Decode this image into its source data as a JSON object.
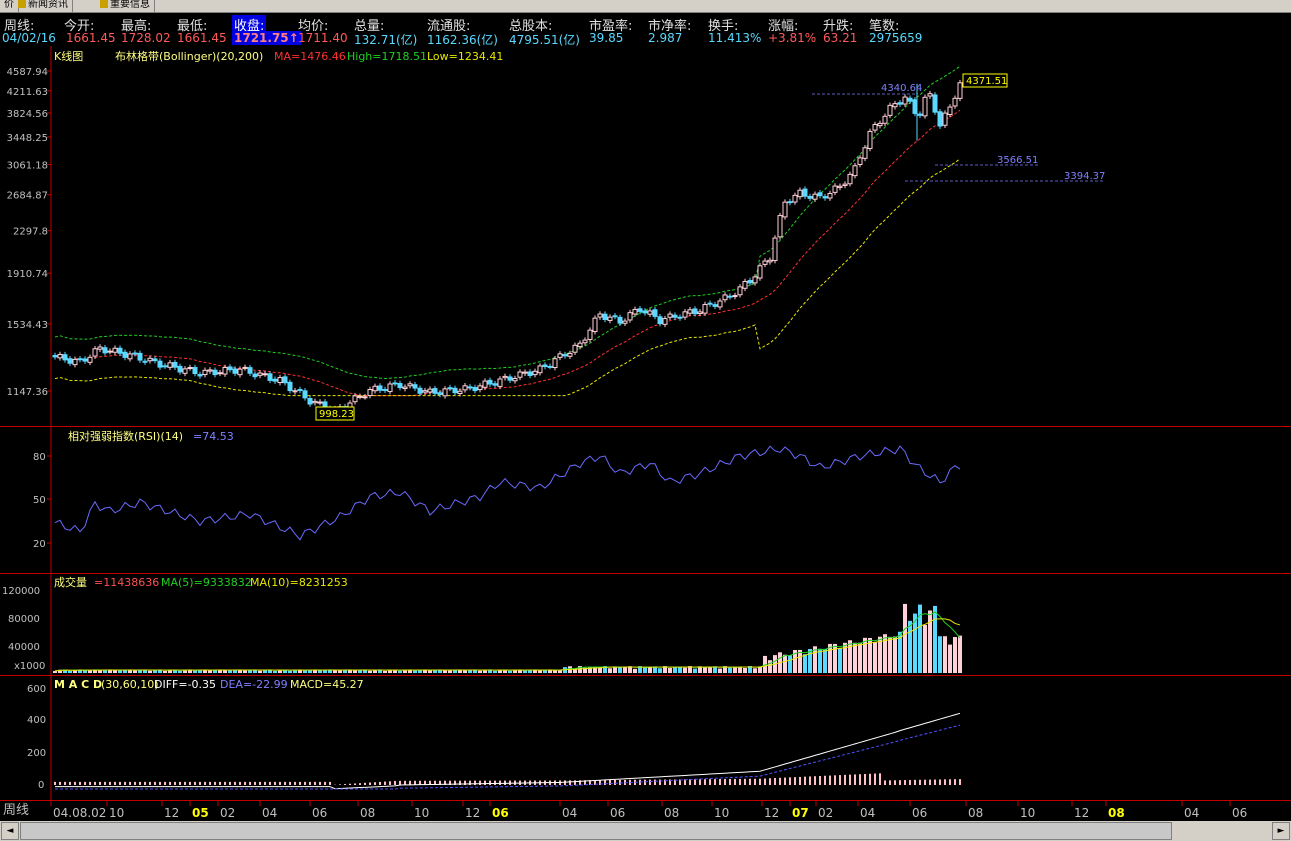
{
  "tabs": [
    {
      "label": "价"
    },
    {
      "label": "新闻资讯"
    },
    {
      "label": "重要信息"
    }
  ],
  "quote_headers": [
    "周线:",
    "今开:",
    "最高:",
    "最低:",
    "收盘:",
    "均价:",
    "总量:",
    "流通股:",
    "总股本:",
    "市盈率:",
    "市净率:",
    "换手:",
    "涨幅:",
    "升跌:",
    "笔数:"
  ],
  "quote_values": [
    "04/02/16",
    "1661.45",
    "1728.02",
    "1661.45",
    "1721.75↑",
    "1711.40",
    "132.71(亿)",
    "1162.36(亿)",
    "4795.51(亿)",
    "39.85",
    "2.987",
    "11.413%",
    "+3.81%",
    "63.21",
    "2975659"
  ],
  "colors": {
    "up": "#ff5a5a",
    "down": "#5ad8ff",
    "ma": "#ff3030",
    "upper_band": "#20d020",
    "lower_band": "#e8e800",
    "rsi": "#6a6aff",
    "macd_diff": "#ffffff",
    "macd_dea": "#5050ff",
    "grid": "#c00000",
    "highlight": "#ffff00"
  },
  "kline": {
    "title": "K线图",
    "indicator": "布林格带(Bollinger)(20,200)",
    "ma_label": "MA=1476.46",
    "high_label": "High=1718.51",
    "low_label": "Low=1234.41",
    "y_ticks": [
      "4587.94",
      "4211.63",
      "3824.56",
      "3448.25",
      "3061.18",
      "2684.87",
      "2297.8",
      "1910.74",
      "1534.43",
      "1147.36"
    ],
    "y_values": [
      4587.94,
      4211.63,
      3824.56,
      3448.25,
      3061.18,
      2684.87,
      2297.8,
      1910.74,
      1534.43,
      1147.36
    ],
    "annotations": [
      "4371.51",
      "4340.64",
      "3566.51",
      "3394.37",
      "998.23"
    ]
  },
  "rsi": {
    "title": "相对强弱指数(RSI)(14)",
    "value_label": "=74.53",
    "y_ticks": [
      "80",
      "50",
      "20"
    ]
  },
  "volume": {
    "title": "成交量",
    "value_label": "=11438636",
    "ma5_label": "MA(5)=9333832",
    "ma10_label": "MA(10)=8231253",
    "y_ticks": [
      "120000",
      "80000",
      "40000",
      "x1000"
    ]
  },
  "macd": {
    "title": "M A C D",
    "params": "(30,60,10)",
    "diff_label": "DIFF=-0.35",
    "dea_label": "DEA=-22.99",
    "macd_label": "MACD=45.27",
    "y_ticks": [
      "600",
      "400",
      "200",
      "0"
    ]
  },
  "x_axis": {
    "period_label": "周线",
    "labels": [
      "04.08.02",
      "10",
      "12",
      "05",
      "02",
      "04",
      "06",
      "08",
      "10",
      "12",
      "06",
      "04",
      "06",
      "08",
      "10",
      "12",
      "07",
      "02",
      "04",
      "06",
      "08",
      "10",
      "12",
      "08",
      "04",
      "06"
    ],
    "years": [
      "05",
      "06",
      "07",
      "08"
    ]
  }
}
